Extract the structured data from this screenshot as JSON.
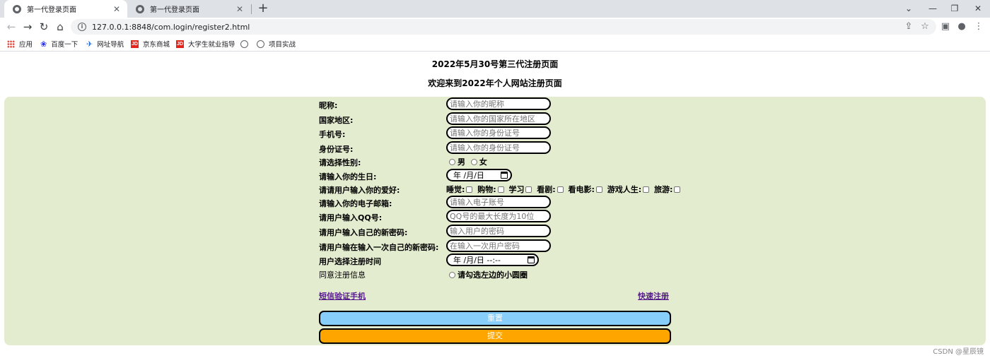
{
  "browser": {
    "tabs": [
      {
        "title": "第一代登录页面",
        "close": "✕"
      },
      {
        "title": "第一代登录页面",
        "close": "✕"
      }
    ],
    "new_tab": "+",
    "window_controls": {
      "dropdown": "⌄",
      "minimize": "—",
      "restore": "❐",
      "close": "✕"
    },
    "url": "127.0.0.1:8848/com.login/register2.html",
    "bookmarks": [
      {
        "label": "应用",
        "icon": "apps-grid-icon"
      },
      {
        "label": "百度一下",
        "icon": "baidu-paw-icon"
      },
      {
        "label": "网址导航",
        "icon": "nav-icon"
      },
      {
        "label": "京东商城",
        "icon": "jd-icon"
      },
      {
        "label": "大学生就业指导",
        "icon": "jd-icon"
      },
      {
        "label": "",
        "icon": "globe-icon"
      },
      {
        "label": "项目实战",
        "icon": "globe-icon"
      }
    ]
  },
  "page": {
    "title_line1": "2022年5月30号第三代注册页面",
    "title_line2": "欢迎来到2022年个人网站注册页面"
  },
  "form": {
    "nickname": {
      "label": "昵称:",
      "placeholder": "请输入你的昵称"
    },
    "region": {
      "label": "国家地区:",
      "placeholder": "请输入你的国家所在地区"
    },
    "phone": {
      "label": "手机号:",
      "placeholder": "请输入你的身份证号"
    },
    "id_card": {
      "label": "身份证号:",
      "placeholder": "请输入你的身份证号"
    },
    "gender": {
      "label": "请选择性别:",
      "options": [
        "男",
        "女"
      ]
    },
    "birthday": {
      "label": "请输入你的生日:",
      "value": "年 /月/日"
    },
    "hobbies": {
      "label": "请请用户输入你的爱好:",
      "options": [
        "睡觉:",
        "购物:",
        "学习",
        "看剧:",
        "看电影:",
        "游戏人生:",
        "旅游:"
      ]
    },
    "email": {
      "label": "请输入你的电子邮箱:",
      "placeholder": "请输入电子账号"
    },
    "qq": {
      "label": "请用户输入QQ号:",
      "placeholder": "QQ号的最大长度为10位"
    },
    "password": {
      "label": "请用户输入自己的新密码:",
      "placeholder": "输入用户的密码"
    },
    "password_confirm": {
      "label": "请用户输在输入一次自己的新密码:",
      "placeholder": "在输入一次用户密码"
    },
    "register_time": {
      "label": "用户选择注册时间",
      "value": "年 /月/日 --:--"
    },
    "agree": {
      "label": "同意注册信息",
      "option": "请勾选左边的小圆圈"
    },
    "sms_link": "短信验证手机",
    "quick_link": "快速注册",
    "reset_button": "重置",
    "submit_button": "提交"
  },
  "colors": {
    "panel_bg": "#e3eccf",
    "reset_bg": "#87cefa",
    "submit_bg": "#ffa500",
    "link": "#551a8b"
  },
  "watermark": "CSDN @星辰镜"
}
